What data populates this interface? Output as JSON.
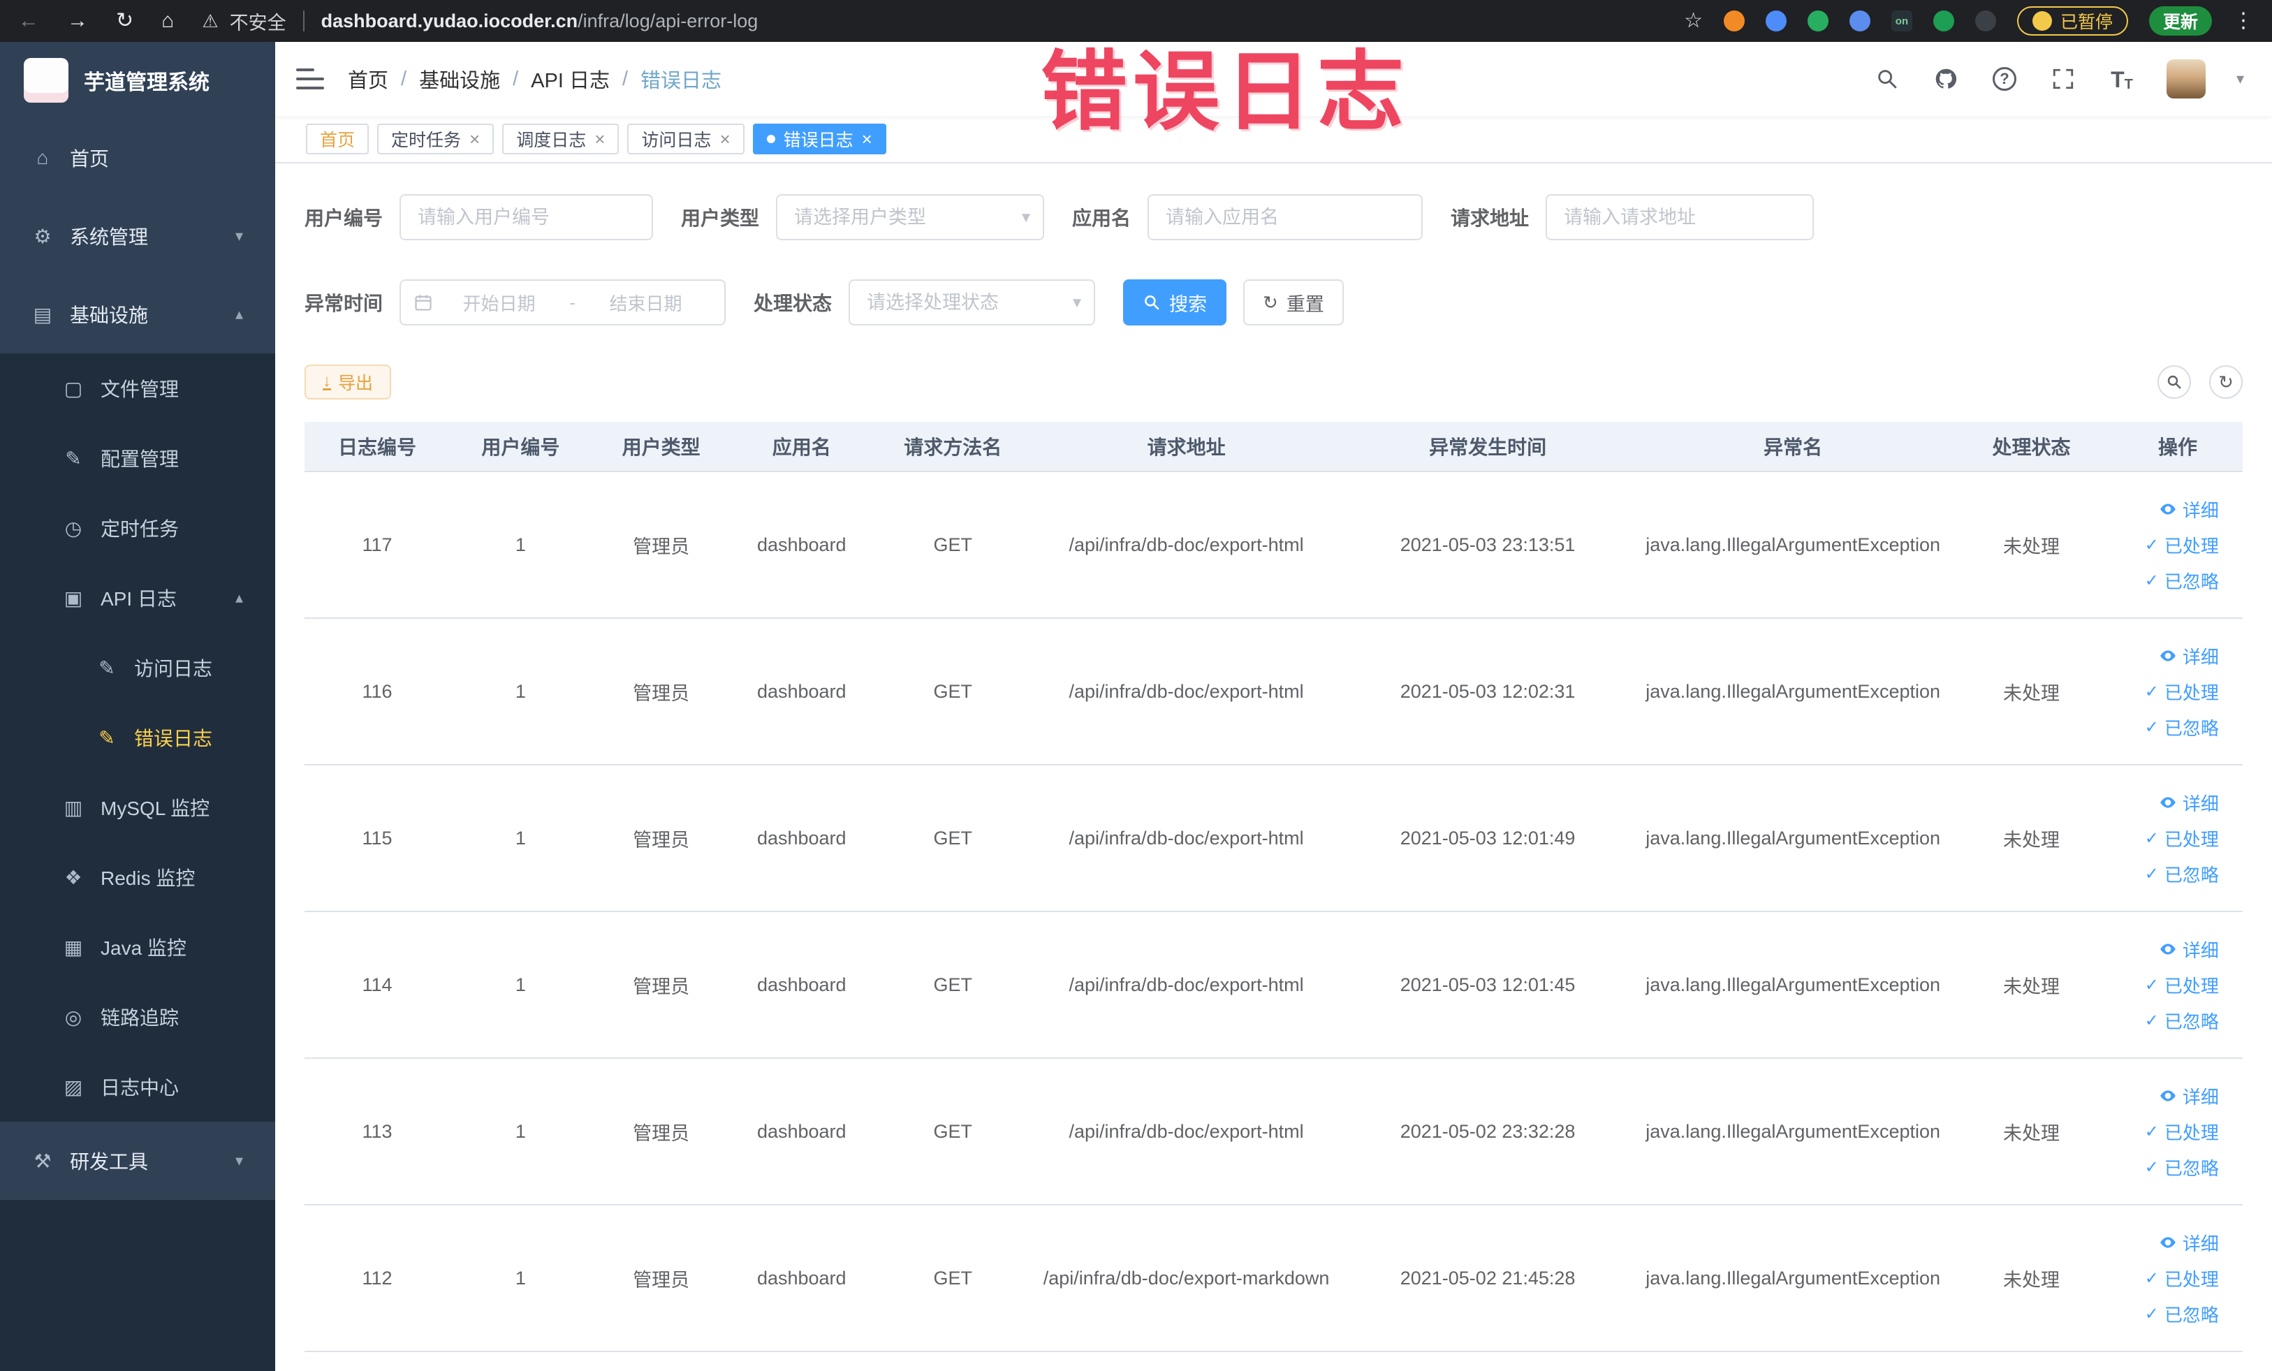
{
  "colors": {
    "accent_blue": "#409eff",
    "sidebar_bg": "#304156",
    "submenu_bg": "#1f2d3d",
    "active_menu_text": "#ffd04b",
    "watermark_pink": "#ee4560",
    "warning_orange": "#e6a23c"
  },
  "icons": {
    "back": "←",
    "forward": "→",
    "reload": "↻",
    "home": "⌂",
    "warning": "⚠",
    "star": "☆",
    "kebab": "⋮",
    "caret_down": "▾",
    "close": "×",
    "check": "✓",
    "refresh": "↻",
    "download": "↓",
    "font_t": "T"
  },
  "browser": {
    "security_warning": "不安全",
    "url_domain": "dashboard.yudao.iocoder.cn",
    "url_path": "/infra/log/api-error-log",
    "ext_on_label": "on",
    "paused_badge": "已暂停",
    "update_button": "更新"
  },
  "watermark": "错误日志",
  "sidebar": {
    "title": "芋道管理系统",
    "menu": [
      {
        "label": "首页",
        "glyph": "⌂"
      },
      {
        "label": "系统管理",
        "glyph": "⚙",
        "chevron": "▾"
      },
      {
        "label": "基础设施",
        "glyph": "▤",
        "chevron": "▴"
      },
      {
        "label": "文件管理",
        "glyph": "▢"
      },
      {
        "label": "配置管理",
        "glyph": "✎"
      },
      {
        "label": "定时任务",
        "glyph": "◷"
      },
      {
        "label": "API 日志",
        "glyph": "▣",
        "chevron": "▴"
      },
      {
        "label": "访问日志",
        "glyph": "✎"
      },
      {
        "label": "错误日志",
        "glyph": "✎"
      },
      {
        "label": "MySQL 监控",
        "glyph": "▥"
      },
      {
        "label": "Redis 监控",
        "glyph": "❖"
      },
      {
        "label": "Java 监控",
        "glyph": "▦"
      },
      {
        "label": "链路追踪",
        "glyph": "◎"
      },
      {
        "label": "日志中心",
        "glyph": "▨"
      },
      {
        "label": "研发工具",
        "glyph": "⚒",
        "chevron": "▾"
      }
    ]
  },
  "header": {
    "breadcrumb": [
      {
        "label": "首页"
      },
      {
        "label": "基础设施"
      },
      {
        "label": "API 日志"
      },
      {
        "label": "错误日志"
      }
    ],
    "separator": "/"
  },
  "tabs": [
    {
      "label": "首页"
    },
    {
      "label": "定时任务"
    },
    {
      "label": "调度日志"
    },
    {
      "label": "访问日志"
    },
    {
      "label": "错误日志"
    }
  ],
  "filters": {
    "user_id_label": "用户编号",
    "user_id_placeholder": "请输入用户编号",
    "user_type_label": "用户类型",
    "user_type_placeholder": "请选择用户类型",
    "app_name_label": "应用名",
    "app_name_placeholder": "请输入应用名",
    "request_url_label": "请求地址",
    "request_url_placeholder": "请输入请求地址",
    "exception_time_label": "异常时间",
    "date_start_placeholder": "开始日期",
    "date_separator": "-",
    "date_end_placeholder": "结束日期",
    "process_status_label": "处理状态",
    "process_status_placeholder": "请选择处理状态",
    "search_button": "搜索",
    "reset_button": "重置"
  },
  "toolbar": {
    "export_button": "导出"
  },
  "table": {
    "columns": [
      "日志编号",
      "用户编号",
      "用户类型",
      "应用名",
      "请求方法名",
      "请求地址",
      "异常发生时间",
      "异常名",
      "处理状态",
      "操作"
    ],
    "action_detail": "详细",
    "action_processed": "已处理",
    "action_ignored": "已忽略",
    "rows": [
      {
        "id": "117",
        "user_id": "1",
        "user_type": "管理员",
        "app_name": "dashboard",
        "method": "GET",
        "url": "/api/infra/db-doc/export-html",
        "time": "2021-05-03 23:13:51",
        "exception": "java.lang.IllegalArgumentException",
        "status": "未处理"
      },
      {
        "id": "116",
        "user_id": "1",
        "user_type": "管理员",
        "app_name": "dashboard",
        "method": "GET",
        "url": "/api/infra/db-doc/export-html",
        "time": "2021-05-03 12:02:31",
        "exception": "java.lang.IllegalArgumentException",
        "status": "未处理"
      },
      {
        "id": "115",
        "user_id": "1",
        "user_type": "管理员",
        "app_name": "dashboard",
        "method": "GET",
        "url": "/api/infra/db-doc/export-html",
        "time": "2021-05-03 12:01:49",
        "exception": "java.lang.IllegalArgumentException",
        "status": "未处理"
      },
      {
        "id": "114",
        "user_id": "1",
        "user_type": "管理员",
        "app_name": "dashboard",
        "method": "GET",
        "url": "/api/infra/db-doc/export-html",
        "time": "2021-05-03 12:01:45",
        "exception": "java.lang.IllegalArgumentException",
        "status": "未处理"
      },
      {
        "id": "113",
        "user_id": "1",
        "user_type": "管理员",
        "app_name": "dashboard",
        "method": "GET",
        "url": "/api/infra/db-doc/export-html",
        "time": "2021-05-02 23:32:28",
        "exception": "java.lang.IllegalArgumentException",
        "status": "未处理"
      },
      {
        "id": "112",
        "user_id": "1",
        "user_type": "管理员",
        "app_name": "dashboard",
        "method": "GET",
        "url": "/api/infra/db-doc/export-markdown",
        "time": "2021-05-02 21:45:28",
        "exception": "java.lang.IllegalArgumentException",
        "status": "未处理"
      }
    ]
  }
}
